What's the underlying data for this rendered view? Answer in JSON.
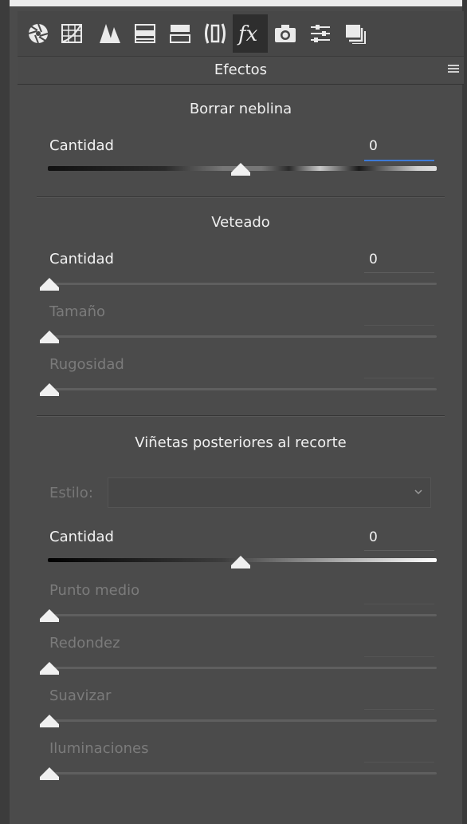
{
  "toolbar": {
    "icons": [
      "aperture-icon",
      "tone-curve-icon",
      "detail-icon",
      "hsl-icon",
      "split-toning-icon",
      "lens-icon",
      "fx-icon",
      "camera-icon",
      "presets-icon",
      "snapshots-icon"
    ],
    "active": "fx-icon"
  },
  "header": {
    "title": "Efectos"
  },
  "haze": {
    "title": "Borrar neblina",
    "amount_label": "Cantidad",
    "amount_value": "0"
  },
  "grain": {
    "title": "Veteado",
    "amount_label": "Cantidad",
    "amount_value": "0",
    "size_label": "Tamaño",
    "roughness_label": "Rugosidad"
  },
  "vignette": {
    "title": "Viñetas posteriores al recorte",
    "style_label": "Estilo:",
    "amount_label": "Cantidad",
    "amount_value": "0",
    "midpoint_label": "Punto medio",
    "roundness_label": "Redondez",
    "feather_label": "Suavizar",
    "highlights_label": "Iluminaciones"
  },
  "colors": {
    "panel_bg": "#4b4b4b",
    "accent_blue": "#3d7ad8"
  }
}
